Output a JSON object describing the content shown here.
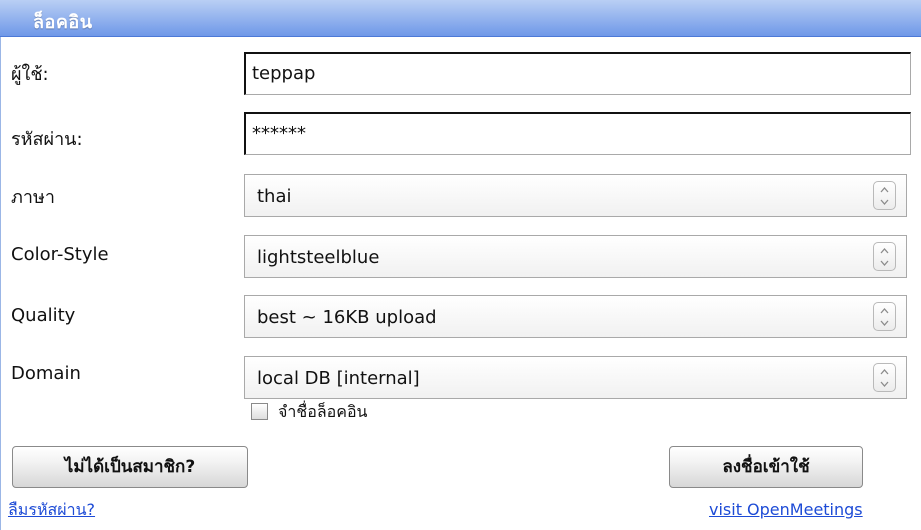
{
  "window": {
    "title": "ล็อคอิน"
  },
  "form": {
    "username": {
      "label": "ผู้ใช้:",
      "value": "teppap"
    },
    "password": {
      "label": "รหัสผ่าน:",
      "value": "******"
    },
    "language": {
      "label": "ภาษา",
      "value": "thai"
    },
    "color_style": {
      "label": "Color-Style",
      "value": "lightsteelblue"
    },
    "quality": {
      "label": "Quality",
      "value": "best ~ 16KB upload"
    },
    "domain": {
      "label": "Domain",
      "value": "local DB [internal]"
    },
    "remember_login": {
      "label": "จำชื่อล็อคอิน",
      "checked": false
    }
  },
  "actions": {
    "not_member": "ไม่ได้เป็นสมาชิก?",
    "login": "ลงชื่อเข้าใช้",
    "forgot_password": "ลืมรหัสผ่าน?",
    "visit_openmeetings": "visit OpenMeetings"
  },
  "icons": {
    "spinner_up": "chevron-up-icon",
    "spinner_down": "chevron-down-icon"
  },
  "colors": {
    "title_bar": "#6f98e8",
    "link": "#1d4bd6"
  }
}
